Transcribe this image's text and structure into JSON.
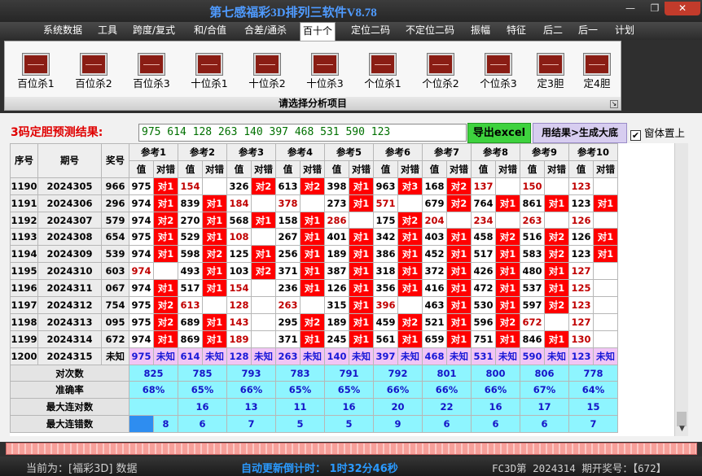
{
  "app": {
    "title": "第七感福彩3D排列三软件V8.78"
  },
  "window": {
    "minimize": "—",
    "maximize": "❐",
    "close": "✕"
  },
  "menu": [
    "系统数据",
    "工具",
    "跨度/复式",
    "和/合值",
    "合差/通杀",
    "百十个",
    "定位二码",
    "不定位二码",
    "振幅",
    "特征",
    "后二",
    "后一",
    "计划"
  ],
  "menu_active": "百十个",
  "tools": [
    "百位杀1",
    "百位杀2",
    "百位杀3",
    "十位杀1",
    "十位杀2",
    "十位杀3",
    "个位杀1",
    "个位杀2",
    "个位杀3",
    "定3胆",
    "定4胆"
  ],
  "tool_caption": "请选择分析项目",
  "prediction": {
    "label": "3码定胆预测结果:",
    "value": "975 614 128 263 140 397 468 531 590 123",
    "export_button": "导出excel",
    "generate_button": "用结果>生成大底",
    "ontop_label": "窗体置上",
    "ontop_checked": true
  },
  "table": {
    "headers": {
      "id": "序号",
      "period": "期号",
      "draw": "奖号",
      "value": "值",
      "check": "对错"
    },
    "refs": [
      "参考1",
      "参考2",
      "参考3",
      "参考4",
      "参考5",
      "参考6",
      "参考7",
      "参考8",
      "参考9",
      "参考10"
    ],
    "rows": [
      {
        "id": "1190",
        "period": "2024305",
        "draw": "966",
        "cells": [
          [
            "975",
            "对1"
          ],
          [
            "154",
            ""
          ],
          [
            "326",
            "对2"
          ],
          [
            "613",
            "对2"
          ],
          [
            "398",
            "对1"
          ],
          [
            "963",
            "对3"
          ],
          [
            "168",
            "对2"
          ],
          [
            "137",
            ""
          ],
          [
            "150",
            ""
          ],
          [
            "123",
            ""
          ]
        ]
      },
      {
        "id": "1191",
        "period": "2024306",
        "draw": "296",
        "cells": [
          [
            "974",
            "对1"
          ],
          [
            "839",
            "对1"
          ],
          [
            "184",
            ""
          ],
          [
            "378",
            ""
          ],
          [
            "273",
            "对1"
          ],
          [
            "571",
            ""
          ],
          [
            "679",
            "对2"
          ],
          [
            "764",
            "对1"
          ],
          [
            "861",
            "对1"
          ],
          [
            "123",
            "对1"
          ]
        ]
      },
      {
        "id": "1192",
        "period": "2024307",
        "draw": "579",
        "cells": [
          [
            "974",
            "对2"
          ],
          [
            "270",
            "对1"
          ],
          [
            "568",
            "对1"
          ],
          [
            "158",
            "对1"
          ],
          [
            "286",
            ""
          ],
          [
            "175",
            "对2"
          ],
          [
            "204",
            ""
          ],
          [
            "234",
            ""
          ],
          [
            "263",
            ""
          ],
          [
            "126",
            ""
          ]
        ]
      },
      {
        "id": "1193",
        "period": "2024308",
        "draw": "654",
        "cells": [
          [
            "975",
            "对1"
          ],
          [
            "529",
            "对1"
          ],
          [
            "108",
            ""
          ],
          [
            "267",
            "对1"
          ],
          [
            "401",
            "对1"
          ],
          [
            "342",
            "对1"
          ],
          [
            "403",
            "对1"
          ],
          [
            "458",
            "对2"
          ],
          [
            "516",
            "对2"
          ],
          [
            "126",
            "对1"
          ]
        ]
      },
      {
        "id": "1194",
        "period": "2024309",
        "draw": "539",
        "cells": [
          [
            "974",
            "对1"
          ],
          [
            "598",
            "对2"
          ],
          [
            "125",
            "对1"
          ],
          [
            "256",
            "对1"
          ],
          [
            "189",
            "对1"
          ],
          [
            "386",
            "对1"
          ],
          [
            "452",
            "对1"
          ],
          [
            "517",
            "对1"
          ],
          [
            "583",
            "对2"
          ],
          [
            "123",
            "对1"
          ]
        ]
      },
      {
        "id": "1195",
        "period": "2024310",
        "draw": "603",
        "cells": [
          [
            "974",
            ""
          ],
          [
            "493",
            "对1"
          ],
          [
            "103",
            "对2"
          ],
          [
            "371",
            "对1"
          ],
          [
            "387",
            "对1"
          ],
          [
            "318",
            "对1"
          ],
          [
            "372",
            "对1"
          ],
          [
            "426",
            "对1"
          ],
          [
            "480",
            "对1"
          ],
          [
            "127",
            ""
          ]
        ]
      },
      {
        "id": "1196",
        "period": "2024311",
        "draw": "067",
        "cells": [
          [
            "974",
            "对1"
          ],
          [
            "517",
            "对1"
          ],
          [
            "154",
            ""
          ],
          [
            "236",
            "对1"
          ],
          [
            "126",
            "对1"
          ],
          [
            "356",
            "对1"
          ],
          [
            "416",
            "对1"
          ],
          [
            "472",
            "对1"
          ],
          [
            "537",
            "对1"
          ],
          [
            "125",
            ""
          ]
        ]
      },
      {
        "id": "1197",
        "period": "2024312",
        "draw": "754",
        "cells": [
          [
            "975",
            "对2"
          ],
          [
            "613",
            ""
          ],
          [
            "128",
            ""
          ],
          [
            "263",
            ""
          ],
          [
            "315",
            "对1"
          ],
          [
            "396",
            ""
          ],
          [
            "463",
            "对1"
          ],
          [
            "530",
            "对1"
          ],
          [
            "597",
            "对2"
          ],
          [
            "123",
            ""
          ]
        ]
      },
      {
        "id": "1198",
        "period": "2024313",
        "draw": "095",
        "cells": [
          [
            "975",
            "对2"
          ],
          [
            "689",
            "对1"
          ],
          [
            "143",
            ""
          ],
          [
            "295",
            "对2"
          ],
          [
            "189",
            "对1"
          ],
          [
            "459",
            "对2"
          ],
          [
            "521",
            "对1"
          ],
          [
            "596",
            "对2"
          ],
          [
            "672",
            ""
          ],
          [
            "127",
            ""
          ]
        ]
      },
      {
        "id": "1199",
        "period": "2024314",
        "draw": "672",
        "cells": [
          [
            "974",
            "对1"
          ],
          [
            "869",
            "对1"
          ],
          [
            "189",
            ""
          ],
          [
            "371",
            "对1"
          ],
          [
            "245",
            "对1"
          ],
          [
            "561",
            "对1"
          ],
          [
            "659",
            "对1"
          ],
          [
            "751",
            "对1"
          ],
          [
            "846",
            "对1"
          ],
          [
            "130",
            ""
          ]
        ]
      }
    ],
    "pending": {
      "id": "1200",
      "period": "2024315",
      "draw": "未知",
      "values": [
        "975",
        "614",
        "128",
        "263",
        "140",
        "397",
        "468",
        "531",
        "590",
        "123"
      ],
      "status": "未知"
    },
    "stats": [
      {
        "label": "对次数",
        "values": [
          "825",
          "785",
          "793",
          "783",
          "791",
          "792",
          "801",
          "800",
          "806",
          "778"
        ]
      },
      {
        "label": "准确率",
        "values": [
          "68%",
          "65%",
          "66%",
          "65%",
          "65%",
          "66%",
          "66%",
          "66%",
          "67%",
          "64%"
        ]
      },
      {
        "label": "最大连对数",
        "values": [
          "16",
          "13",
          "11",
          "16",
          "20",
          "22",
          "16",
          "17",
          "15"
        ]
      },
      {
        "label": "最大连错数",
        "values": [
          "8",
          "6",
          "7",
          "5",
          "5",
          "9",
          "6",
          "6",
          "6",
          "7"
        ]
      }
    ]
  },
  "status": {
    "left": "当前为：[福彩3D] 数据",
    "countdown": "自动更新倒计时： 1时32分46秒",
    "right": "FC3D第 2024314 期开奖号：【672】"
  }
}
